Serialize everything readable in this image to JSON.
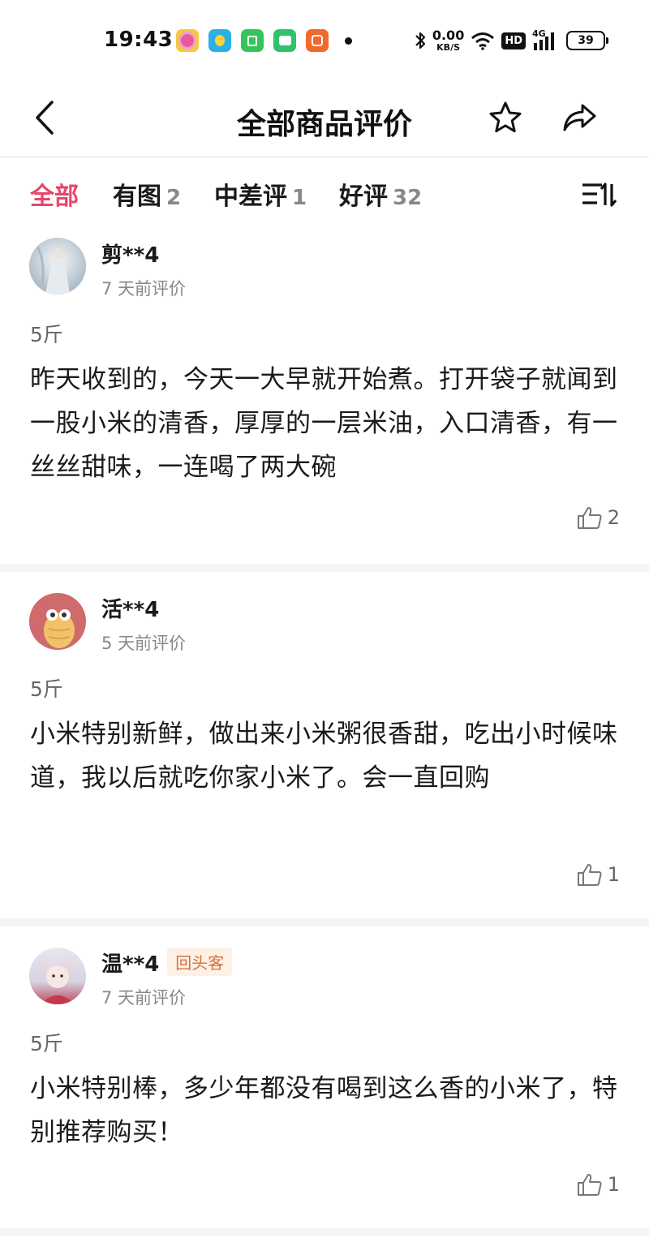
{
  "status_bar": {
    "time": "19:43",
    "net_speed_value": "0.00",
    "net_speed_unit": "KB/S",
    "hd": "HD",
    "signal": "4G",
    "battery": "39"
  },
  "header": {
    "title": "全部商品评价"
  },
  "filters": {
    "all_label": "全部",
    "pics_label": "有图",
    "pics_count": "2",
    "mid_label": "中差评",
    "mid_count": "1",
    "good_label": "好评",
    "good_count": "32"
  },
  "reviews": [
    {
      "username": "剪**4",
      "time": "7 天前评价",
      "spec": "5斤",
      "text": "昨天收到的，今天一大早就开始煮。打开袋子就闻到一股小米的清香，厚厚的一层米油，入口清香，有一丝丝甜味，一连喝了两大碗",
      "likes": "2"
    },
    {
      "username": "活**4",
      "time": "5 天前评价",
      "spec": "5斤",
      "text": "小米特别新鲜，做出来小米粥很香甜，吃出小时候味道，我以后就吃你家小米了。会一直回购",
      "likes": "1"
    },
    {
      "username": "温**4",
      "badge": "回头客",
      "time": "7 天前评价",
      "spec": "5斤",
      "text": "小米特别棒，多少年都没有喝到这么香的小米了，特别推荐购买！",
      "likes": "1"
    }
  ],
  "colors": {
    "accent": "#e8466a",
    "badge_text": "#d4713a",
    "badge_bg": "#fdf1e6"
  }
}
